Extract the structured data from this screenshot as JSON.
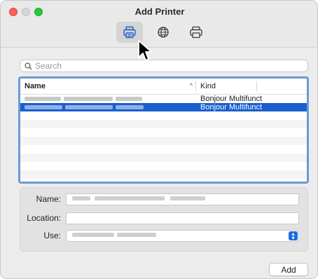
{
  "window": {
    "title": "Add Printer"
  },
  "toolbar": {
    "buttons": [
      {
        "name": "default",
        "icon": "printer-icon"
      },
      {
        "name": "ip",
        "icon": "globe-icon"
      },
      {
        "name": "windows",
        "icon": "printer-outline-icon"
      }
    ]
  },
  "search": {
    "placeholder": "Search",
    "value": ""
  },
  "table": {
    "columns": {
      "name": "Name",
      "kind": "Kind",
      "sort_indicator": "^"
    },
    "rows": [
      {
        "name": "",
        "kind": "Bonjour Multifunct",
        "selected": false
      },
      {
        "name": "",
        "kind": "Bonjour Multifunct",
        "selected": true
      }
    ]
  },
  "form": {
    "name_label": "Name:",
    "location_label": "Location:",
    "use_label": "Use:",
    "name_value": "",
    "location_value": "",
    "use_value": ""
  },
  "actions": {
    "add_label": "Add"
  },
  "colors": {
    "accent": "#1a5fce",
    "selection": "#1a5fce",
    "focus_ring": "#6a9bd3"
  }
}
